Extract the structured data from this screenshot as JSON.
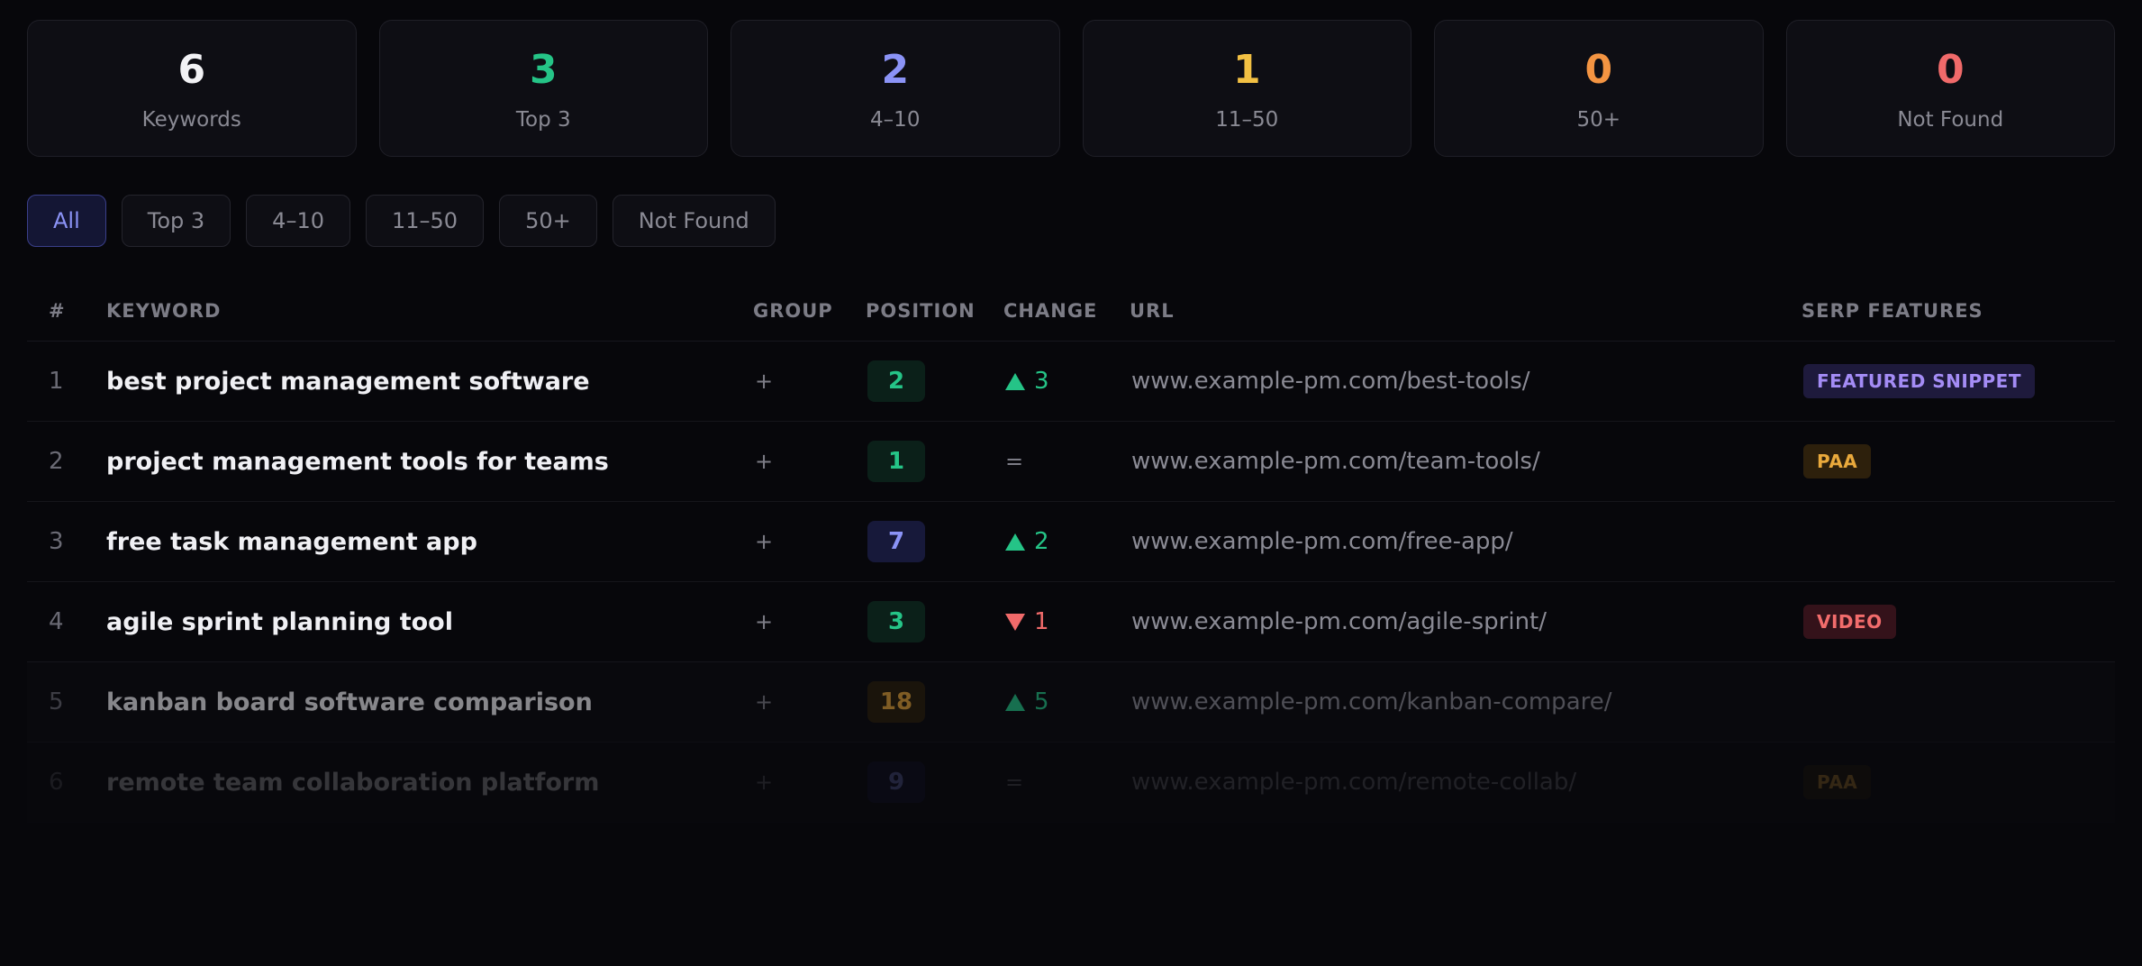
{
  "stats": [
    {
      "value": "6",
      "label": "Keywords",
      "color": "#f2f2f5"
    },
    {
      "value": "3",
      "label": "Top 3",
      "color": "#25c487"
    },
    {
      "value": "2",
      "label": "4–10",
      "color": "#8b93f6"
    },
    {
      "value": "1",
      "label": "11–50",
      "color": "#f2c043"
    },
    {
      "value": "0",
      "label": "50+",
      "color": "#f39442"
    },
    {
      "value": "0",
      "label": "Not Found",
      "color": "#f06a6a"
    }
  ],
  "filters": {
    "active": "All",
    "items": [
      "All",
      "Top 3",
      "4–10",
      "11–50",
      "50+",
      "Not Found"
    ]
  },
  "table": {
    "headers": {
      "num": "#",
      "keyword": "KEYWORD",
      "group": "GROUP",
      "position": "POSITION",
      "change": "CHANGE",
      "url": "URL",
      "serp": "SERP FEATURES"
    },
    "group_add_label": "+",
    "rows": [
      {
        "num": "1",
        "keyword": "best project management software",
        "position": "2",
        "position_tone": "green",
        "change_direction": "up",
        "change": "3",
        "url": "www.example-pm.com/best-tools/",
        "serp": "FEATURED SNIPPET",
        "serp_tone": "fs"
      },
      {
        "num": "2",
        "keyword": "project management tools for teams",
        "position": "1",
        "position_tone": "green",
        "change_direction": "same",
        "change": "=",
        "url": "www.example-pm.com/team-tools/",
        "serp": "PAA",
        "serp_tone": "paa"
      },
      {
        "num": "3",
        "keyword": "free task management app",
        "position": "7",
        "position_tone": "blue",
        "change_direction": "up",
        "change": "2",
        "url": "www.example-pm.com/free-app/",
        "serp": "",
        "serp_tone": ""
      },
      {
        "num": "4",
        "keyword": "agile sprint planning tool",
        "position": "3",
        "position_tone": "green",
        "change_direction": "down",
        "change": "1",
        "url": "www.example-pm.com/agile-sprint/",
        "serp": "VIDEO",
        "serp_tone": "video"
      },
      {
        "num": "5",
        "keyword": "kanban board software comparison",
        "position": "18",
        "position_tone": "amber",
        "change_direction": "up",
        "change": "5",
        "url": "www.example-pm.com/kanban-compare/",
        "serp": "",
        "serp_tone": ""
      },
      {
        "num": "6",
        "keyword": "remote team collaboration platform",
        "position": "9",
        "position_tone": "blue",
        "change_direction": "same",
        "change": "=",
        "url": "www.example-pm.com/remote-collab/",
        "serp": "PAA",
        "serp_tone": "paa"
      }
    ]
  }
}
